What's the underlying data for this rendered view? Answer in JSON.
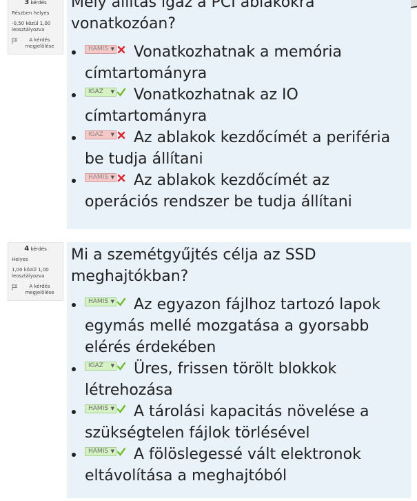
{
  "questions": [
    {
      "number": "3",
      "kerdes_label": "kérdés",
      "state": "Részben helyes",
      "grade": "-0,50 közül 1,00 leosztályozva",
      "flag_label": "A kérdés megjelölése",
      "text": "Mely állítás igaz a PCI ablakokra vonatkozóan?",
      "answers": [
        {
          "choice": "HAMIS",
          "correct": false,
          "text": "Vonatkozhatnak a memória címtartományra"
        },
        {
          "choice": "IGAZ",
          "correct": true,
          "text": "Vonatkozhatnak az IO címtartományra"
        },
        {
          "choice": "IGAZ",
          "correct": false,
          "text": "Az ablakok kezdőcímét a periféria be tudja állítani"
        },
        {
          "choice": "HAMIS",
          "correct": false,
          "text": "Az ablakok kezdőcímét az operációs rendszer be tudja állítani"
        }
      ]
    },
    {
      "number": "4",
      "kerdes_label": "kérdés",
      "state": "Helyes",
      "grade": "1,00 közül 1,00 leosztályozva",
      "flag_label": "A kérdés megjelölése",
      "text": "Mi a szemétgyűjtés célja az SSD meghajtókban?",
      "answers": [
        {
          "choice": "HAMIS",
          "correct": true,
          "text": "Az egyazon fájlhoz tartozó lapok egymás mellé mozgatása a gyorsabb elérés érdekében"
        },
        {
          "choice": "IGAZ",
          "correct": true,
          "text": "Üres, frissen törölt blokkok létrehozása"
        },
        {
          "choice": "HAMIS",
          "correct": true,
          "text": "A tárolási kapacitás növelése a szükségtelen fájlok törlésével"
        },
        {
          "choice": "HAMIS",
          "correct": true,
          "text": "A fölöslegessé vált elektronok eltávolítása a meghajtóból"
        }
      ]
    }
  ],
  "colors": {
    "correct_bg": "#d5f2c3",
    "incorrect_bg": "#f6c8c8",
    "correct_mark": "#6cbf1e",
    "incorrect_mark": "#e8202a",
    "question_bg": "#e8f2f8"
  }
}
